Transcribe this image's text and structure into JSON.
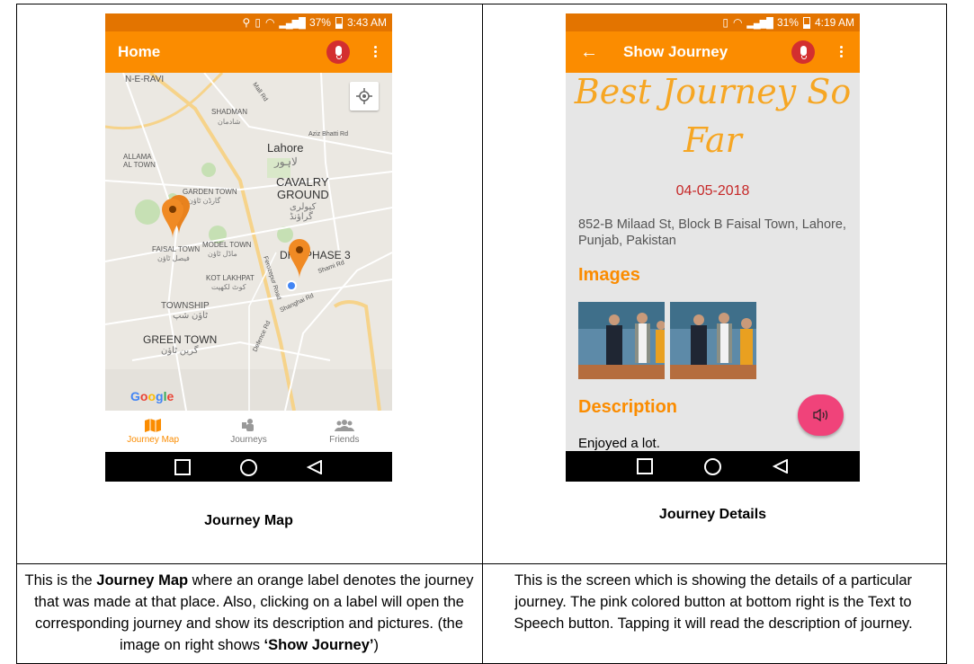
{
  "left_phone": {
    "status_battery": "37%",
    "status_time": "3:43 AM",
    "appbar_title": "Home",
    "map_labels": {
      "shadman": "SHADMAN",
      "shadman_urdu": "شادمان",
      "lahore": "Lahore",
      "lahore_urdu": "لاہور",
      "allama": "ALLAMA",
      "al_town": "AL TOWN",
      "cavalry": "CAVALRY",
      "ground": "GROUND",
      "cavalry_urdu": "کیولری",
      "ground_urdu": "گراؤنڈ",
      "garden_town": "GARDEN TOWN",
      "garden_urdu": "گارڈن ٹاؤن",
      "faisal_town": "FAISAL TOWN",
      "faisal_urdu": "فیصل ٹاؤن",
      "model_town": "MODEL TOWN",
      "model_urdu": "ماڈل ٹاؤن",
      "phase": "DHA PHASE 3",
      "kot": "KOT LAKHPAT",
      "kot_urdu": "کوٹ لکھپت",
      "township": "TOWNSHIP",
      "township_urdu": "ٹاؤن شپ",
      "green_town": "GREEN TOWN",
      "green_urdu": "گرین ٹاؤن",
      "ferozepur": "Ferozepur Road",
      "shami": "Shami Rd",
      "shanghai": "Shanghai Rd",
      "defence": "Defence Rd",
      "rafi": "Aziz Bhatti Rd",
      "mall": "Mall Rd",
      "top_left": "N-E-RAVI",
      "google": "Google"
    },
    "nav": [
      {
        "label": "Journey Map"
      },
      {
        "label": "Journeys"
      },
      {
        "label": "Friends"
      }
    ]
  },
  "right_phone": {
    "status_battery": "31%",
    "status_time": "4:19 AM",
    "appbar_title": "Show Journey",
    "journey_title_line1": "Best Journey So",
    "journey_title_line2": "Far",
    "date": "04-05-2018",
    "address": "852-B Milaad St, Block B Faisal Town, Lahore, Punjab, Pakistan",
    "images_heading": "Images",
    "description_heading": "Description",
    "description_text": "Enjoyed a lot."
  },
  "captions": {
    "left": "Journey Map",
    "right": "Journey Details"
  },
  "descriptions": {
    "left_prefix": "This is the ",
    "left_bold": "Journey Map",
    "left_rest": " where an orange label denotes the journey that was made at that place. Also, clicking on a label will open the corresponding journey and show its description and pictures. (the image on right shows ",
    "left_quote": "‘Show Journey’",
    "left_end": ")",
    "right": "This is the screen which is showing the details of a particular journey. The pink colored button at bottom right is the Text to Speech button. Tapping it will read the description of journey."
  },
  "colors": {
    "appbar": "#fb8c00",
    "status": "#e37400",
    "fab": "#f0437a",
    "date": "#c62828"
  }
}
